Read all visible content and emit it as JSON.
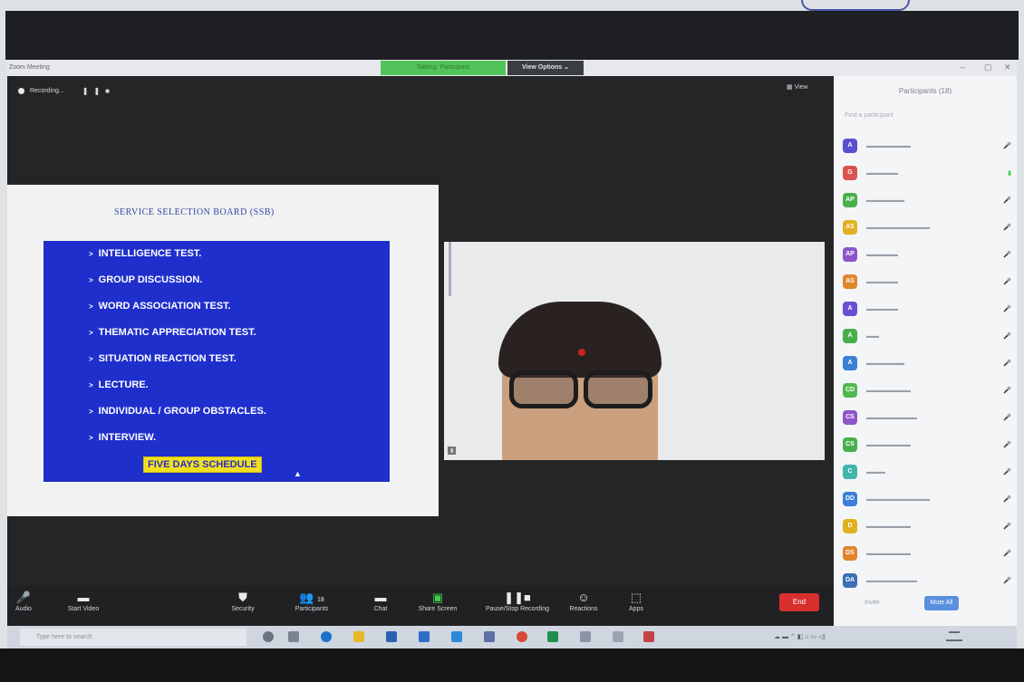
{
  "window": {
    "app_title": "Zoom Meeting",
    "talking_label": "Talking: Participant",
    "view_options_label": "View Options ⌄"
  },
  "recording": {
    "label": "Recording..."
  },
  "view_label": "View",
  "slide": {
    "title": "SERVICE SELECTION BOARD (SSB)",
    "bullets": [
      "INTELLIGENCE TEST.",
      "GROUP DISCUSSION.",
      "WORD ASSOCIATION TEST.",
      "THEMATIC APPRECIATION TEST.",
      "SITUATION REACTION TEST.",
      "LECTURE.",
      "INDIVIDUAL / GROUP OBSTACLES.",
      "INTERVIEW."
    ],
    "highlight": "FIVE DAYS SCHEDULE"
  },
  "toolbar": {
    "audio": "Audio",
    "start_video": "Start Video",
    "security": "Security",
    "participants": "Participants",
    "participants_count": "18",
    "chat": "Chat",
    "share_screen": "Share Screen",
    "pause_recording": "Pause/Stop Recording",
    "reactions": "Reactions",
    "apps": "Apps",
    "end": "End"
  },
  "panel": {
    "title": "Participants (18)",
    "search_placeholder": "Find a participant",
    "invite": "Invite",
    "mute_all": "Mute All",
    "participants": [
      {
        "initials": "A",
        "color": "#5a4fcf"
      },
      {
        "initials": "G",
        "color": "#d9534f"
      },
      {
        "initials": "AP",
        "color": "#47b04b"
      },
      {
        "initials": "AS",
        "color": "#e0b21f"
      },
      {
        "initials": "AP",
        "color": "#8e54c9"
      },
      {
        "initials": "AS",
        "color": "#e0872a"
      },
      {
        "initials": "A",
        "color": "#6a4fd6"
      },
      {
        "initials": "A",
        "color": "#47b04b"
      },
      {
        "initials": "A",
        "color": "#3b7fd6"
      },
      {
        "initials": "CD",
        "color": "#52b84e"
      },
      {
        "initials": "CS",
        "color": "#8e54c9"
      },
      {
        "initials": "CS",
        "color": "#47b04b"
      },
      {
        "initials": "C",
        "color": "#3fb6a8"
      },
      {
        "initials": "DD",
        "color": "#3b7fd6"
      },
      {
        "initials": "D",
        "color": "#e0b21f"
      },
      {
        "initials": "DS",
        "color": "#e0872a"
      },
      {
        "initials": "DA",
        "color": "#3b6fb6"
      }
    ]
  },
  "taskbar": {
    "search_placeholder": "Type here to search"
  },
  "colors": {
    "end_button": "#d92f2f",
    "slide_blue": "#1f2fcc",
    "highlight_yellow": "#f1e01f"
  }
}
